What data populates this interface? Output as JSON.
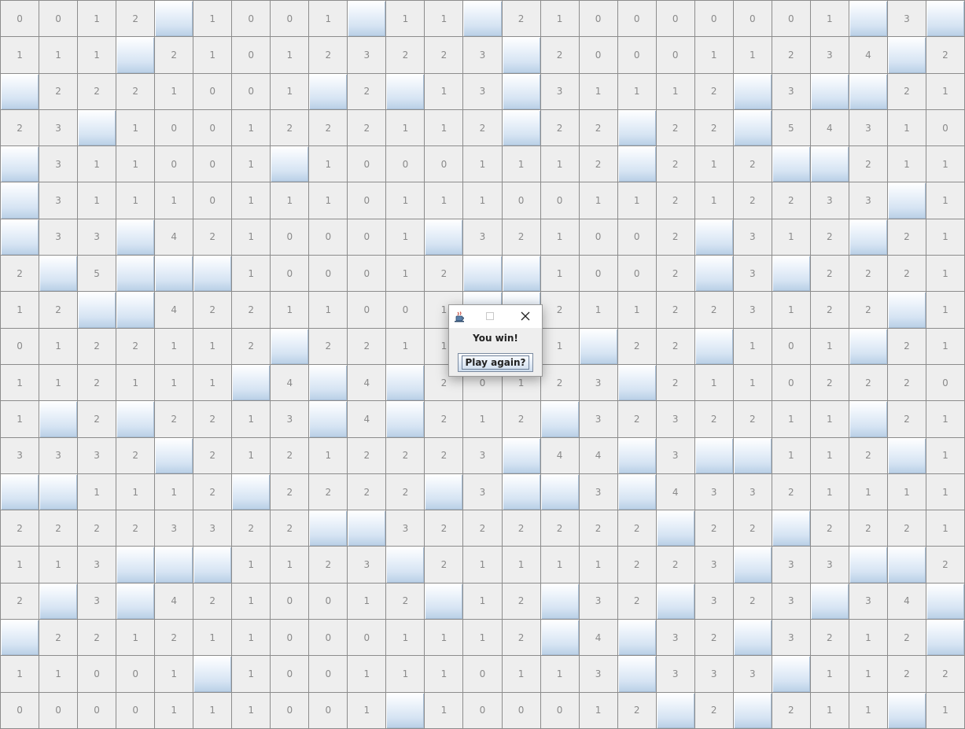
{
  "game": {
    "cols": 25,
    "rows": 20,
    "board": [
      [
        "0",
        "0",
        "1",
        "2",
        "#",
        "1",
        "0",
        "0",
        "1",
        "#",
        "1",
        "1",
        "#",
        "2",
        "1",
        "0",
        "0",
        "0",
        "0",
        "0",
        "0",
        "1",
        "#",
        "3",
        "#"
      ],
      [
        "1",
        "1",
        "1",
        "#",
        "2",
        "1",
        "0",
        "1",
        "2",
        "3",
        "2",
        "2",
        "3",
        "#",
        "2",
        "0",
        "0",
        "0",
        "1",
        "1",
        "2",
        "3",
        "4",
        "#",
        "2"
      ],
      [
        "#",
        "2",
        "2",
        "2",
        "1",
        "0",
        "0",
        "1",
        "#",
        "2",
        "#",
        "1",
        "3",
        "#",
        "3",
        "1",
        "1",
        "1",
        "2",
        "#",
        "3",
        "#",
        "#",
        "2",
        "1"
      ],
      [
        "2",
        "3",
        "#",
        "1",
        "0",
        "0",
        "1",
        "2",
        "2",
        "2",
        "1",
        "1",
        "2",
        "#",
        "2",
        "2",
        "#",
        "2",
        "2",
        "#",
        "5",
        "4",
        "3",
        "1",
        "0"
      ],
      [
        "#",
        "3",
        "1",
        "1",
        "0",
        "0",
        "1",
        "#",
        "1",
        "0",
        "0",
        "0",
        "1",
        "1",
        "1",
        "2",
        "#",
        "2",
        "1",
        "2",
        "#",
        "#",
        "2",
        "1",
        "1"
      ],
      [
        "#",
        "3",
        "1",
        "1",
        "1",
        "0",
        "1",
        "1",
        "1",
        "0",
        "1",
        "1",
        "1",
        "0",
        "0",
        "1",
        "1",
        "2",
        "1",
        "2",
        "2",
        "3",
        "3",
        "#",
        "1"
      ],
      [
        "#",
        "3",
        "3",
        "#",
        "4",
        "2",
        "1",
        "0",
        "0",
        "0",
        "1",
        "#",
        "3",
        "2",
        "1",
        "0",
        "0",
        "2",
        "#",
        "3",
        "1",
        "2",
        "#",
        "2",
        "1"
      ],
      [
        "2",
        "#",
        "5",
        "#",
        "#",
        "#",
        "1",
        "0",
        "0",
        "0",
        "1",
        "2",
        "#",
        "#",
        "1",
        "0",
        "0",
        "2",
        "#",
        "3",
        "#",
        "2",
        "2",
        "2",
        "1"
      ],
      [
        "1",
        "2",
        "#",
        "#",
        "4",
        "2",
        "2",
        "1",
        "1",
        "0",
        "0",
        "1",
        "#",
        "#",
        "2",
        "1",
        "1",
        "2",
        "2",
        "3",
        "1",
        "2",
        "2",
        "#",
        "1"
      ],
      [
        "0",
        "1",
        "2",
        "2",
        "1",
        "1",
        "2",
        "#",
        "2",
        "2",
        "1",
        "1",
        "1",
        "2",
        "1",
        "#",
        "2",
        "2",
        "#",
        "1",
        "0",
        "1",
        "#",
        "2",
        "1"
      ],
      [
        "1",
        "1",
        "2",
        "1",
        "1",
        "1",
        "#",
        "4",
        "#",
        "4",
        "#",
        "2",
        "0",
        "1",
        "2",
        "3",
        "#",
        "2",
        "1",
        "1",
        "0",
        "2",
        "2",
        "2",
        "0"
      ],
      [
        "1",
        "#",
        "2",
        "#",
        "2",
        "2",
        "1",
        "3",
        "#",
        "4",
        "#",
        "2",
        "1",
        "2",
        "#",
        "3",
        "2",
        "3",
        "2",
        "2",
        "1",
        "1",
        "#",
        "2",
        "1"
      ],
      [
        "3",
        "3",
        "3",
        "2",
        "#",
        "2",
        "1",
        "2",
        "1",
        "2",
        "2",
        "2",
        "3",
        "#",
        "4",
        "4",
        "#",
        "3",
        "#",
        "#",
        "1",
        "1",
        "2",
        "#",
        "1"
      ],
      [
        "#",
        "#",
        "1",
        "1",
        "1",
        "2",
        "#",
        "2",
        "2",
        "2",
        "2",
        "#",
        "3",
        "#",
        "#",
        "3",
        "#",
        "4",
        "3",
        "3",
        "2",
        "1",
        "1",
        "1",
        "1"
      ],
      [
        "2",
        "2",
        "2",
        "2",
        "3",
        "3",
        "2",
        "2",
        "#",
        "#",
        "3",
        "2",
        "2",
        "2",
        "2",
        "2",
        "2",
        "#",
        "2",
        "2",
        "#",
        "2",
        "2",
        "2",
        "1"
      ],
      [
        "1",
        "1",
        "3",
        "#",
        "#",
        "#",
        "1",
        "1",
        "2",
        "3",
        "#",
        "2",
        "1",
        "1",
        "1",
        "1",
        "2",
        "2",
        "3",
        "#",
        "3",
        "3",
        "#",
        "#",
        "2"
      ],
      [
        "2",
        "#",
        "3",
        "#",
        "4",
        "2",
        "1",
        "0",
        "0",
        "1",
        "2",
        "#",
        "1",
        "2",
        "#",
        "3",
        "2",
        "#",
        "3",
        "2",
        "3",
        "#",
        "3",
        "4",
        "#"
      ],
      [
        "#",
        "2",
        "2",
        "1",
        "2",
        "1",
        "1",
        "0",
        "0",
        "0",
        "1",
        "1",
        "1",
        "2",
        "#",
        "4",
        "#",
        "3",
        "2",
        "#",
        "3",
        "2",
        "1",
        "2",
        "#"
      ],
      [
        "1",
        "1",
        "0",
        "0",
        "1",
        "#",
        "1",
        "0",
        "0",
        "1",
        "1",
        "1",
        "0",
        "1",
        "1",
        "3",
        "#",
        "3",
        "3",
        "3",
        "#",
        "1",
        "1",
        "2",
        "2"
      ],
      [
        "0",
        "0",
        "0",
        "0",
        "1",
        "1",
        "1",
        "0",
        "0",
        "1",
        "#",
        "1",
        "0",
        "0",
        "0",
        "1",
        "2",
        "#",
        "2",
        "#",
        "2",
        "1",
        "1",
        "#",
        "1"
      ]
    ]
  },
  "dialog": {
    "message": "You win!",
    "button_label": "Play again?",
    "close_glyph": "✕"
  },
  "colors": {
    "number_text": "#8a8a8a",
    "revealed_bg": "#eeeeee",
    "grid_line": "#8c8c8c",
    "covered_top": "#ffffff",
    "covered_bottom": "#b8cfe6"
  }
}
